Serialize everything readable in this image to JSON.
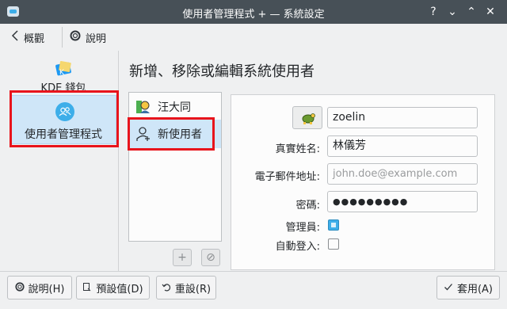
{
  "window": {
    "title": "使用者管理程式 + — 系統設定",
    "buttons": [
      "?",
      "⌄",
      "⌃",
      "✕"
    ]
  },
  "toolbar": {
    "back_label": "概觀",
    "help_label": "說明"
  },
  "sidebar": {
    "items": [
      {
        "label": "KDE 錢包"
      },
      {
        "label": "使用者管理程式"
      }
    ]
  },
  "page": {
    "heading": "新增、移除或編輯系統使用者"
  },
  "users": {
    "list": [
      {
        "name": "汪大同"
      },
      {
        "name": "新使用者"
      }
    ],
    "add_symbol": "+",
    "remove_symbol": "⊘"
  },
  "form": {
    "username_value": "zoelin",
    "real_name_label": "真實姓名:",
    "real_name_value": "林儀芳",
    "email_label": "電子郵件地址:",
    "email_placeholder": "john.doe@example.com",
    "password_label": "密碼:",
    "password_value": "●●●●●●●●●",
    "admin_label": "管理員:",
    "admin_checked": true,
    "autologin_label": "自動登入:",
    "autologin_checked": false
  },
  "footer": {
    "help_label": "說明(H)",
    "defaults_label": "預設值(D)",
    "reset_label": "重設(R)",
    "apply_label": "套用(A)"
  },
  "colors": {
    "accent": "#3daee9",
    "selection": "#cfe6f8",
    "highlight_box": "#e8141c",
    "titlebar": "#475057"
  }
}
